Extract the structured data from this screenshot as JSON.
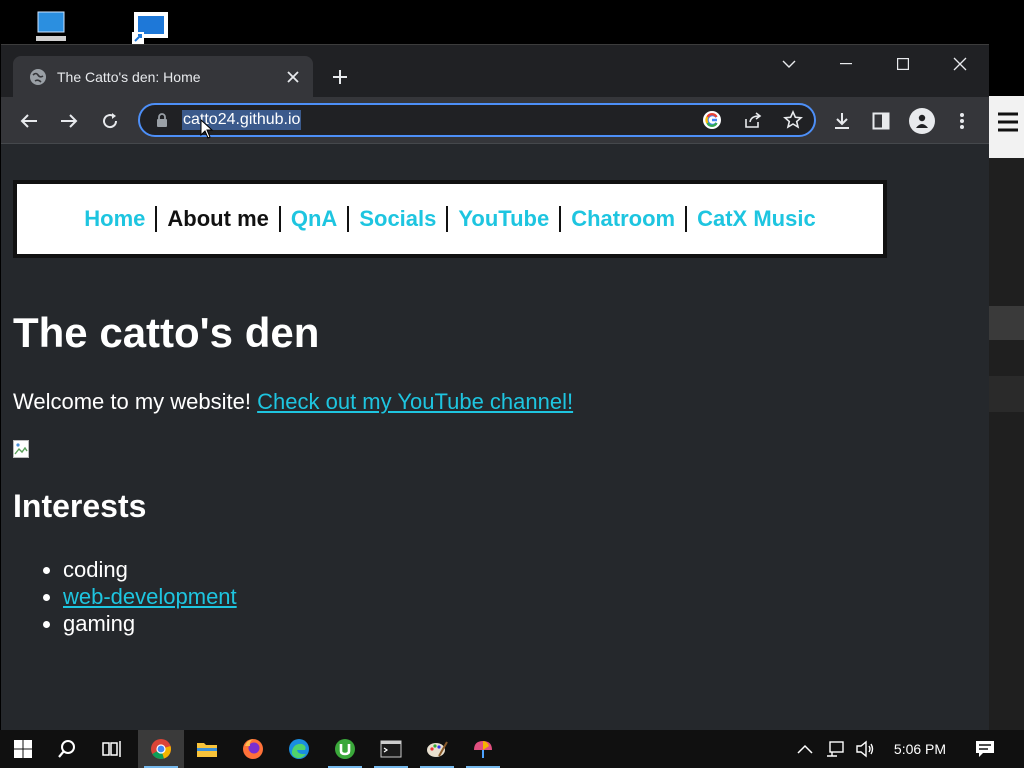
{
  "desktop": {
    "icons": [
      "this-pc-icon",
      "shortcut-icon"
    ]
  },
  "browser": {
    "tab": {
      "title": "The Catto's den: Home",
      "favicon": "globe-icon"
    },
    "address_bar": {
      "url": "catto24.github.io"
    }
  },
  "page": {
    "nav": {
      "items": [
        {
          "label": "Home",
          "current": false
        },
        {
          "label": "About me",
          "current": true
        },
        {
          "label": "QnA",
          "current": false
        },
        {
          "label": "Socials",
          "current": false
        },
        {
          "label": "YouTube",
          "current": false
        },
        {
          "label": "Chatroom",
          "current": false
        },
        {
          "label": "CatX Music",
          "current": false
        }
      ]
    },
    "heading": "The catto's den",
    "welcome_text": "Welcome to my website!",
    "youtube_link": "Check out my YouTube channel!",
    "interests_heading": "Interests",
    "interests": [
      {
        "label": "coding",
        "link": false
      },
      {
        "label": "web-development",
        "link": true
      },
      {
        "label": "gaming",
        "link": false
      }
    ]
  },
  "taskbar": {
    "clock": "5:06 PM"
  },
  "colors": {
    "link": "#1ec5e0",
    "page_bg": "#25282c",
    "accent": "#4d8ff7"
  }
}
